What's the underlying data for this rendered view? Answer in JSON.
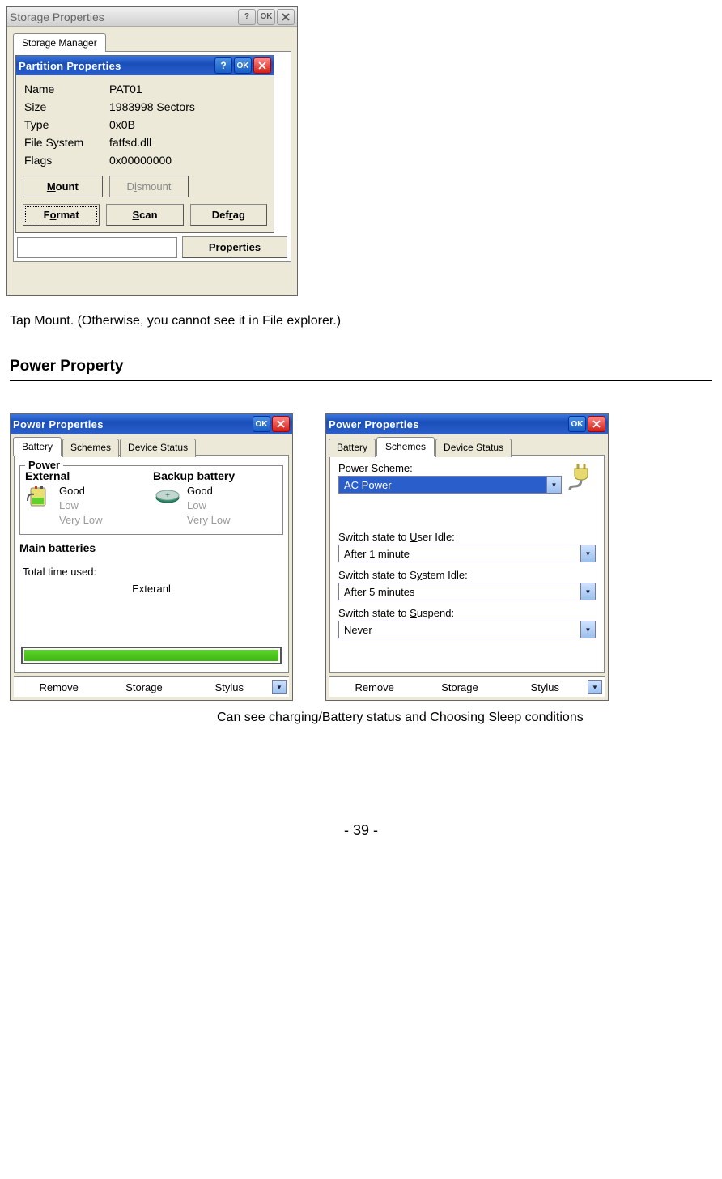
{
  "storage_window": {
    "title": "Storage Properties",
    "btn_help": "?",
    "btn_ok": "OK",
    "tab": "Storage Manager"
  },
  "partition_window": {
    "title": "Partition Properties",
    "btn_help": "?",
    "btn_ok": "OK",
    "rows": [
      {
        "label": "Name",
        "value": "PAT01"
      },
      {
        "label": "Size",
        "value": "1983998 Sectors"
      },
      {
        "label": "Type",
        "value": "0x0B"
      },
      {
        "label": "File System",
        "value": "fatfsd.dll"
      },
      {
        "label": "Flags",
        "value": "0x00000000"
      }
    ],
    "btn_mount_pre": "",
    "btn_mount_u": "M",
    "btn_mount_post": "ount",
    "btn_dismount_pre": "D",
    "btn_dismount_u": "i",
    "btn_dismount_post": "smount",
    "btn_format_pre": "F",
    "btn_format_u": "o",
    "btn_format_post": "rmat",
    "btn_scan_pre": "",
    "btn_scan_u": "S",
    "btn_scan_post": "can",
    "btn_defrag_pre": "Def",
    "btn_defrag_u": "r",
    "btn_defrag_post": "ag",
    "btn_properties_pre": "",
    "btn_properties_u": "P",
    "btn_properties_post": "roperties"
  },
  "text_mount": "Tap Mount. (Otherwise, you cannot see it in File explorer.)",
  "heading_power": "Power Property",
  "power_common": {
    "title": "Power Properties",
    "btn_ok": "OK",
    "tabs": {
      "battery": "Battery",
      "schemes": "Schemes",
      "device": "Device Status"
    },
    "footer": {
      "remove": "Remove",
      "storage": "Storage",
      "stylus": "Stylus"
    }
  },
  "power_battery": {
    "legend": "Power",
    "external_h": "External",
    "backup_h": "Backup battery",
    "status_good": "Good",
    "status_low": "Low",
    "status_vlow": "Very Low",
    "main_h": "Main batteries",
    "total_time": "Total time used:",
    "external_label": "Exteranl",
    "progress_pct": 100
  },
  "power_schemes": {
    "scheme_label_pre": "",
    "scheme_label_u": "P",
    "scheme_label_post": "ower Scheme:",
    "scheme_value": "AC Power",
    "user_idle_pre": "Switch state to ",
    "user_idle_u": "U",
    "user_idle_post": "ser Idle:",
    "user_idle_value": "After 1 minute",
    "sys_idle_pre": "Switch state to S",
    "sys_idle_u": "y",
    "sys_idle_post": "stem Idle:",
    "sys_idle_value": "After 5 minutes",
    "suspend_pre": "Switch state to ",
    "suspend_u": "S",
    "suspend_post": "uspend:",
    "suspend_value": "Never"
  },
  "caption": "Can see charging/Battery status and Choosing Sleep conditions",
  "page_number": "- 39 -"
}
